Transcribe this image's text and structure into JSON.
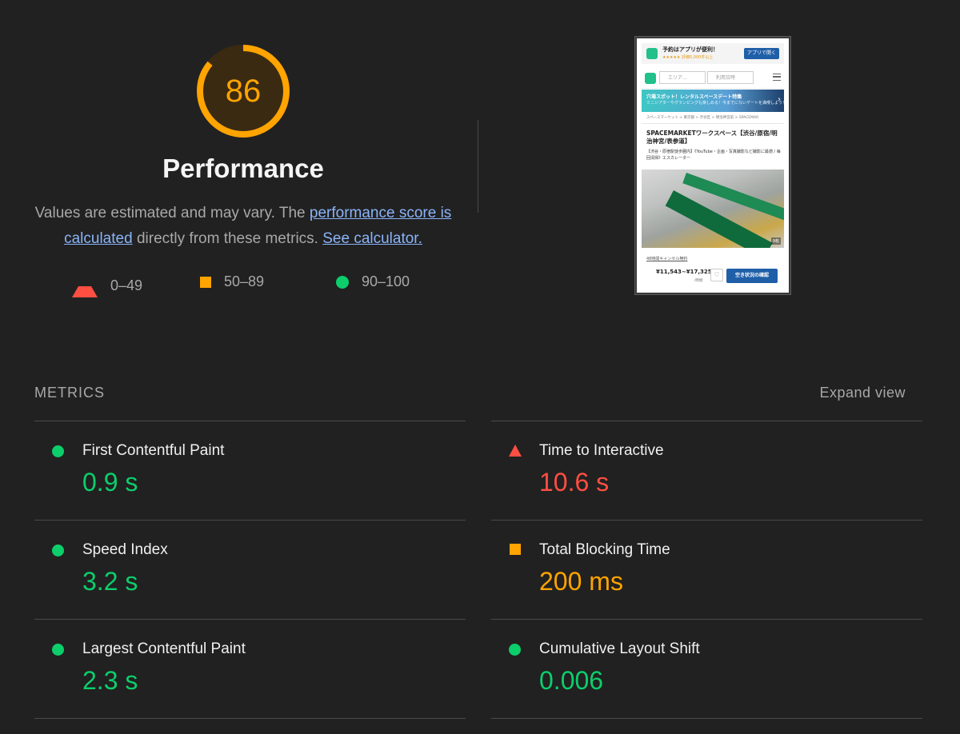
{
  "score": {
    "value": "86",
    "fraction": 0.86,
    "title": "Performance",
    "description_prefix": "Values are estimated and may vary. The ",
    "link_score": "performance score is calculated",
    "description_middle": " directly from these metrics. ",
    "link_calculator": "See calculator.",
    "colors": {
      "fail": "#ff4e42",
      "average": "#ffa400",
      "pass": "#0cce6b"
    }
  },
  "legend": [
    {
      "range": "0–49",
      "icon": "red-triangle-icon"
    },
    {
      "range": "50–89",
      "icon": "orange-square-icon"
    },
    {
      "range": "90–100",
      "icon": "green-circle-icon"
    }
  ],
  "screenshot": {
    "banner_title": "予約はアプリが便利！",
    "banner_rating": "★★★★★ 評価5,000件以上",
    "banner_button": "アプリで開く",
    "search_placeholder": "エリア…",
    "date_placeholder": "利用日時",
    "promo_title": "穴場スポット！レンタルスペースデート特集",
    "promo_sub": "ミニシアターやグランピングも楽しめる！今までにないデートを満喫しよう！",
    "breadcrumb": "スペースマーケット > 東京都 > 渋谷区 > 明治神宮前 > SPACEMAR",
    "title": "SPACEMARKETワークスペース【渋谷/原宿/明治神宮/表参道】",
    "description": "【渋谷・原宿駅徒歩圏内】《YouTube・企画・写真撮影など撮影に最適 / 毎回清掃》エスカレーター",
    "photo_count": "9枚",
    "cancel_note": "48時間キャンセル無料",
    "price": "¥11,543~¥17,325",
    "price_unit": "/時間",
    "cta": "空き状況の確認"
  },
  "metrics": {
    "header": "METRICS",
    "expand_label": "Expand view",
    "left": [
      {
        "title": "First Contentful Paint",
        "value": "0.9 s",
        "rating": "pass",
        "icon": "green-circle-icon"
      },
      {
        "title": "Speed Index",
        "value": "3.2 s",
        "rating": "pass",
        "icon": "green-circle-icon"
      },
      {
        "title": "Largest Contentful Paint",
        "value": "2.3 s",
        "rating": "pass",
        "icon": "green-circle-icon"
      }
    ],
    "right": [
      {
        "title": "Time to Interactive",
        "value": "10.6 s",
        "rating": "fail",
        "icon": "red-triangle-icon"
      },
      {
        "title": "Total Blocking Time",
        "value": "200 ms",
        "rating": "average",
        "icon": "orange-square-icon"
      },
      {
        "title": "Cumulative Layout Shift",
        "value": "0.006",
        "rating": "pass",
        "icon": "green-circle-icon"
      }
    ]
  }
}
